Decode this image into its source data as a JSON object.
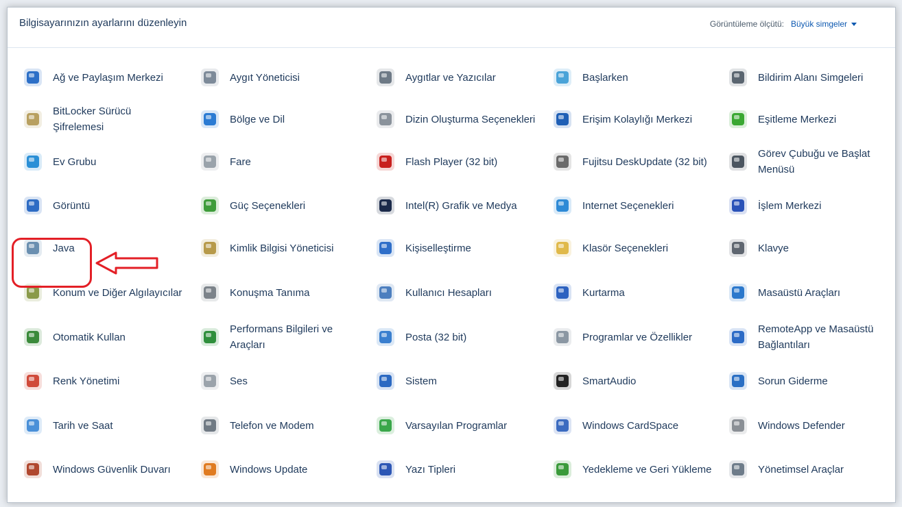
{
  "header": {
    "title": "Bilgisayarınızın ayarlarını düzenleyin",
    "view_by_label": "Görüntüleme ölçütü:",
    "view_by_value": "Büyük simgeler"
  },
  "items": [
    {
      "label": "Ağ ve Paylaşım Merkezi",
      "icon": "network-icon",
      "color": "#2c6fc7"
    },
    {
      "label": "Aygıt Yöneticisi",
      "icon": "device-manager-icon",
      "color": "#7d8a99"
    },
    {
      "label": "Aygıtlar ve Yazıcılar",
      "icon": "printer-icon",
      "color": "#6e7a86"
    },
    {
      "label": "Başlarken",
      "icon": "getting-started-icon",
      "color": "#4aa3d8"
    },
    {
      "label": "Bildirim Alanı Simgeleri",
      "icon": "notification-icon",
      "color": "#5a6570"
    },
    {
      "label": "BitLocker Sürücü Şifrelemesi",
      "icon": "bitlocker-key-icon",
      "color": "#b8a060"
    },
    {
      "label": "Bölge ve Dil",
      "icon": "globe-clock-icon",
      "color": "#2b7bd3"
    },
    {
      "label": "Dizin Oluşturma Seçenekleri",
      "icon": "indexing-icon",
      "color": "#8a929b"
    },
    {
      "label": "Erişim Kolaylığı Merkezi",
      "icon": "ease-of-access-icon",
      "color": "#1f5fb5"
    },
    {
      "label": "Eşitleme Merkezi",
      "icon": "sync-center-icon",
      "color": "#3aa832"
    },
    {
      "label": "Ev Grubu",
      "icon": "homegroup-icon",
      "color": "#2a8fd6"
    },
    {
      "label": "Fare",
      "icon": "mouse-icon",
      "color": "#9aa3ab"
    },
    {
      "label": "Flash Player (32 bit)",
      "icon": "flash-icon",
      "color": "#c8201e"
    },
    {
      "label": "Fujitsu DeskUpdate (32 bit)",
      "icon": "fujitsu-update-icon",
      "color": "#6a6a6a"
    },
    {
      "label": "Görev Çubuğu ve Başlat Menüsü",
      "icon": "taskbar-icon",
      "color": "#4b5560"
    },
    {
      "label": "Görüntü",
      "icon": "display-icon",
      "color": "#2e6cc4"
    },
    {
      "label": "Güç Seçenekleri",
      "icon": "power-icon",
      "color": "#3e9c3a"
    },
    {
      "label": "Intel(R) Grafik ve Medya",
      "icon": "intel-graphics-icon",
      "color": "#1b2a4a"
    },
    {
      "label": "Internet Seçenekleri",
      "icon": "internet-options-icon",
      "color": "#2e8ad6"
    },
    {
      "label": "İşlem Merkezi",
      "icon": "action-center-flag-icon",
      "color": "#2a52b8"
    },
    {
      "label": "Java",
      "icon": "java-icon",
      "color": "#6a8fb0"
    },
    {
      "label": "Kimlik Bilgisi Yöneticisi",
      "icon": "credential-manager-icon",
      "color": "#b79a4a"
    },
    {
      "label": "Kişiselleştirme",
      "icon": "personalization-icon",
      "color": "#2f6fc9"
    },
    {
      "label": "Klasör Seçenekleri",
      "icon": "folder-options-icon",
      "color": "#e0b94a"
    },
    {
      "label": "Klavye",
      "icon": "keyboard-icon",
      "color": "#5f6670"
    },
    {
      "label": "Konum ve Diğer Algılayıcılar",
      "icon": "location-sensor-icon",
      "color": "#8a9a4a"
    },
    {
      "label": "Konuşma Tanıma",
      "icon": "microphone-icon",
      "color": "#7c838a"
    },
    {
      "label": "Kullanıcı Hesapları",
      "icon": "user-accounts-icon",
      "color": "#4d7fbf"
    },
    {
      "label": "Kurtarma",
      "icon": "recovery-icon",
      "color": "#2d62c0"
    },
    {
      "label": "Masaüstü Araçları",
      "icon": "gadgets-icon",
      "color": "#2b78cc"
    },
    {
      "label": "Otomatik Kullan",
      "icon": "autoplay-icon",
      "color": "#3b8a3b"
    },
    {
      "label": "Performans Bilgileri ve Araçları",
      "icon": "performance-icon",
      "color": "#2f8f3c"
    },
    {
      "label": "Posta (32 bit)",
      "icon": "mail-icon",
      "color": "#3a7fcf"
    },
    {
      "label": "Programlar ve Özellikler",
      "icon": "programs-icon",
      "color": "#8b97a3"
    },
    {
      "label": "RemoteApp ve Masaüstü Bağlantıları",
      "icon": "remoteapp-icon",
      "color": "#2c6bc6"
    },
    {
      "label": "Renk Yönetimi",
      "icon": "color-management-icon",
      "color": "#d04a3a"
    },
    {
      "label": "Ses",
      "icon": "speaker-icon",
      "color": "#9ba3ab"
    },
    {
      "label": "Sistem",
      "icon": "system-icon",
      "color": "#2b69c2"
    },
    {
      "label": "SmartAudio",
      "icon": "headphones-icon",
      "color": "#222222"
    },
    {
      "label": "Sorun Giderme",
      "icon": "troubleshooting-icon",
      "color": "#2a6fc4"
    },
    {
      "label": "Tarih ve Saat",
      "icon": "date-time-icon",
      "color": "#4a90d8"
    },
    {
      "label": "Telefon ve Modem",
      "icon": "phone-modem-icon",
      "color": "#707a84"
    },
    {
      "label": "Varsayılan Programlar",
      "icon": "default-programs-icon",
      "color": "#3aa74a"
    },
    {
      "label": "Windows CardSpace",
      "icon": "cardspace-icon",
      "color": "#3b6bc0"
    },
    {
      "label": "Windows Defender",
      "icon": "defender-icon",
      "color": "#8a8f95"
    },
    {
      "label": "Windows Güvenlik Duvarı",
      "icon": "firewall-icon",
      "color": "#b0472e"
    },
    {
      "label": "Windows Update",
      "icon": "windows-update-icon",
      "color": "#e07b20"
    },
    {
      "label": "Yazı Tipleri",
      "icon": "fonts-icon",
      "color": "#2d57b5"
    },
    {
      "label": "Yedekleme ve Geri Yükleme",
      "icon": "backup-restore-icon",
      "color": "#3a9a3a"
    },
    {
      "label": "Yönetimsel Araçlar",
      "icon": "admin-tools-icon",
      "color": "#6e7c8a"
    }
  ]
}
